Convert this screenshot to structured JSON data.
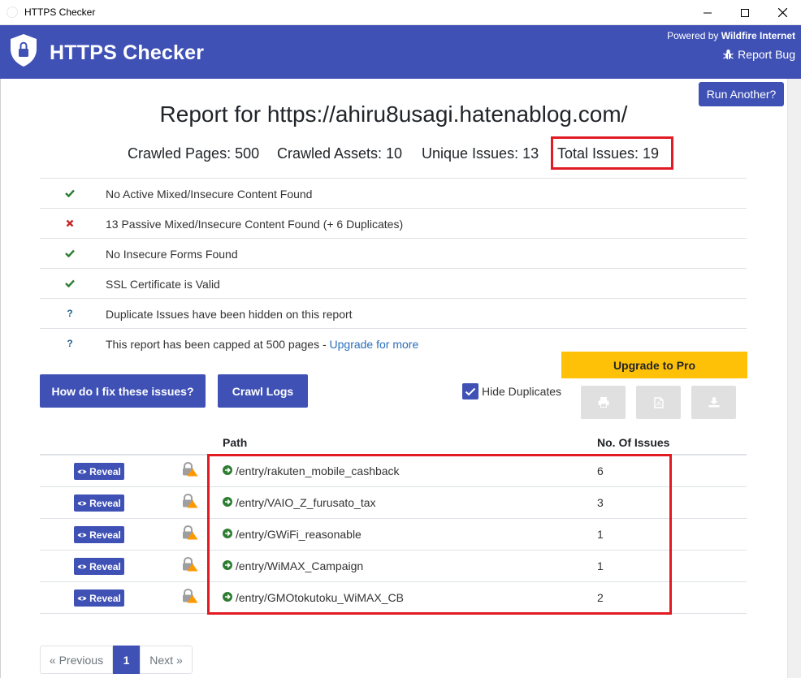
{
  "window": {
    "title": "HTTPS Checker"
  },
  "header": {
    "brand": "HTTPS Checker",
    "powered_prefix": "Powered by ",
    "powered_by": "Wildfire Internet",
    "report_bug": "Report Bug",
    "color": "#3f51b5"
  },
  "actions": {
    "run_another": "Run Another?",
    "upgrade": "Upgrade to Pro",
    "fix_issues": "How do I fix these issues?",
    "crawl_logs": "Crawl Logs",
    "hide_duplicates": "Hide Duplicates",
    "hide_duplicates_checked": true
  },
  "report": {
    "title": "Report for https://ahiru8usagi.hatenablog.com/",
    "stats": {
      "crawled_pages": "Crawled Pages: 500",
      "crawled_assets": "Crawled Assets: 10",
      "unique_issues": "Unique Issues: 13",
      "total_issues": "Total Issues: 19"
    }
  },
  "checks": [
    {
      "status": "ok",
      "icon": "check-icon",
      "text": "No Active Mixed/Insecure Content Found"
    },
    {
      "status": "fail",
      "icon": "cross-icon",
      "text": "13 Passive Mixed/Insecure Content Found (+ 6 Duplicates)"
    },
    {
      "status": "ok",
      "icon": "check-icon",
      "text": "No Insecure Forms Found"
    },
    {
      "status": "ok",
      "icon": "check-icon",
      "text": "SSL Certificate is Valid"
    },
    {
      "status": "info",
      "icon": "question-icon",
      "text": "Duplicate Issues have been hidden on this report"
    },
    {
      "status": "info",
      "icon": "question-icon",
      "text": "This report has been capped at 500 pages - ",
      "link": "Upgrade for more"
    }
  ],
  "table": {
    "headers": {
      "path": "Path",
      "issues": "No. Of Issues"
    },
    "reveal_label": "Reveal",
    "rows": [
      {
        "path": "/entry/rakuten_mobile_cashback",
        "issues": "6"
      },
      {
        "path": "/entry/VAIO_Z_furusato_tax",
        "issues": "3"
      },
      {
        "path": "/entry/GWiFi_reasonable",
        "issues": "1"
      },
      {
        "path": "/entry/WiMAX_Campaign",
        "issues": "1"
      },
      {
        "path": "/entry/GMOtokutoku_WiMAX_CB",
        "issues": "2"
      }
    ]
  },
  "pagination": {
    "previous": "« Previous",
    "current": "1",
    "next": "Next »"
  },
  "colors": {
    "primary": "#3f51b5",
    "warning": "#ffc107",
    "success": "#2e7d32",
    "danger": "#c62828",
    "highlight": "#e01b24"
  }
}
